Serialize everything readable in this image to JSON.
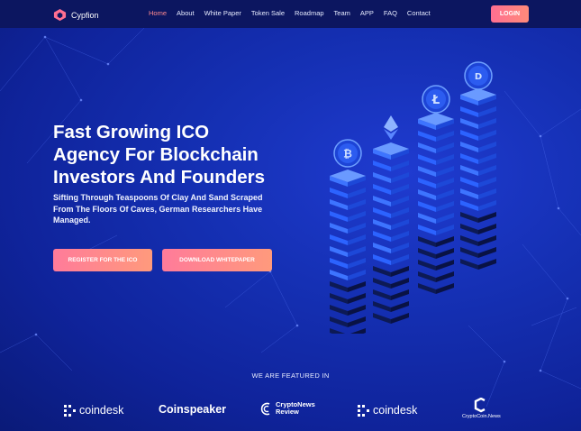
{
  "brand": {
    "name": "Cypfion"
  },
  "nav": {
    "items": [
      "Home",
      "About",
      "White Paper",
      "Token Sale",
      "Roadmap",
      "Team",
      "APP",
      "FAQ",
      "Contact"
    ],
    "active": "Home",
    "login_label": "LOGIN"
  },
  "hero": {
    "title_lines": [
      "Fast Growing ICO",
      "Agency For Blockchain",
      "Investors And Founders"
    ],
    "subtitle_lines": [
      "Sifting Through Teaspoons Of Clay And Sand Scraped",
      "From The Floors Of Caves, German Researchers Have",
      "Managed."
    ],
    "primary_button": "REGISTER FOR THE ICO",
    "secondary_button": "DOWNLOAD WHITEPAPER"
  },
  "illustration": {
    "coins": [
      "bitcoin-icon",
      "ethereum-icon",
      "litecoin-icon",
      "dash-icon"
    ]
  },
  "featured": {
    "title": "WE ARE FEATURED IN",
    "logos": [
      "coindesk",
      "Coinspeaker",
      "CryptoNews",
      "Review",
      "coindesk",
      "CryptoCoin.News"
    ]
  },
  "colors": {
    "background": "#1530b4",
    "header": "#0c1660",
    "accent": "#ff7b9a",
    "nav_active": "#ff8a8f"
  }
}
